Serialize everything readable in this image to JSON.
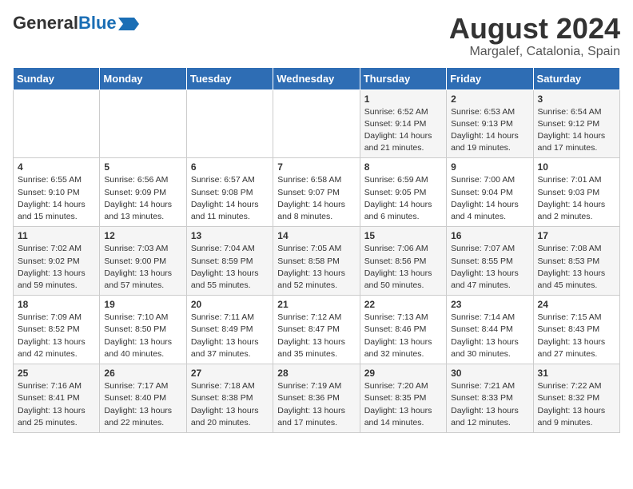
{
  "header": {
    "logo_general": "General",
    "logo_blue": "Blue",
    "title": "August 2024",
    "subtitle": "Margalef, Catalonia, Spain"
  },
  "days_of_week": [
    "Sunday",
    "Monday",
    "Tuesday",
    "Wednesday",
    "Thursday",
    "Friday",
    "Saturday"
  ],
  "weeks": [
    [
      {
        "day": "",
        "info": ""
      },
      {
        "day": "",
        "info": ""
      },
      {
        "day": "",
        "info": ""
      },
      {
        "day": "",
        "info": ""
      },
      {
        "day": "1",
        "info": "Sunrise: 6:52 AM\nSunset: 9:14 PM\nDaylight: 14 hours\nand 21 minutes."
      },
      {
        "day": "2",
        "info": "Sunrise: 6:53 AM\nSunset: 9:13 PM\nDaylight: 14 hours\nand 19 minutes."
      },
      {
        "day": "3",
        "info": "Sunrise: 6:54 AM\nSunset: 9:12 PM\nDaylight: 14 hours\nand 17 minutes."
      }
    ],
    [
      {
        "day": "4",
        "info": "Sunrise: 6:55 AM\nSunset: 9:10 PM\nDaylight: 14 hours\nand 15 minutes."
      },
      {
        "day": "5",
        "info": "Sunrise: 6:56 AM\nSunset: 9:09 PM\nDaylight: 14 hours\nand 13 minutes."
      },
      {
        "day": "6",
        "info": "Sunrise: 6:57 AM\nSunset: 9:08 PM\nDaylight: 14 hours\nand 11 minutes."
      },
      {
        "day": "7",
        "info": "Sunrise: 6:58 AM\nSunset: 9:07 PM\nDaylight: 14 hours\nand 8 minutes."
      },
      {
        "day": "8",
        "info": "Sunrise: 6:59 AM\nSunset: 9:05 PM\nDaylight: 14 hours\nand 6 minutes."
      },
      {
        "day": "9",
        "info": "Sunrise: 7:00 AM\nSunset: 9:04 PM\nDaylight: 14 hours\nand 4 minutes."
      },
      {
        "day": "10",
        "info": "Sunrise: 7:01 AM\nSunset: 9:03 PM\nDaylight: 14 hours\nand 2 minutes."
      }
    ],
    [
      {
        "day": "11",
        "info": "Sunrise: 7:02 AM\nSunset: 9:02 PM\nDaylight: 13 hours\nand 59 minutes."
      },
      {
        "day": "12",
        "info": "Sunrise: 7:03 AM\nSunset: 9:00 PM\nDaylight: 13 hours\nand 57 minutes."
      },
      {
        "day": "13",
        "info": "Sunrise: 7:04 AM\nSunset: 8:59 PM\nDaylight: 13 hours\nand 55 minutes."
      },
      {
        "day": "14",
        "info": "Sunrise: 7:05 AM\nSunset: 8:58 PM\nDaylight: 13 hours\nand 52 minutes."
      },
      {
        "day": "15",
        "info": "Sunrise: 7:06 AM\nSunset: 8:56 PM\nDaylight: 13 hours\nand 50 minutes."
      },
      {
        "day": "16",
        "info": "Sunrise: 7:07 AM\nSunset: 8:55 PM\nDaylight: 13 hours\nand 47 minutes."
      },
      {
        "day": "17",
        "info": "Sunrise: 7:08 AM\nSunset: 8:53 PM\nDaylight: 13 hours\nand 45 minutes."
      }
    ],
    [
      {
        "day": "18",
        "info": "Sunrise: 7:09 AM\nSunset: 8:52 PM\nDaylight: 13 hours\nand 42 minutes."
      },
      {
        "day": "19",
        "info": "Sunrise: 7:10 AM\nSunset: 8:50 PM\nDaylight: 13 hours\nand 40 minutes."
      },
      {
        "day": "20",
        "info": "Sunrise: 7:11 AM\nSunset: 8:49 PM\nDaylight: 13 hours\nand 37 minutes."
      },
      {
        "day": "21",
        "info": "Sunrise: 7:12 AM\nSunset: 8:47 PM\nDaylight: 13 hours\nand 35 minutes."
      },
      {
        "day": "22",
        "info": "Sunrise: 7:13 AM\nSunset: 8:46 PM\nDaylight: 13 hours\nand 32 minutes."
      },
      {
        "day": "23",
        "info": "Sunrise: 7:14 AM\nSunset: 8:44 PM\nDaylight: 13 hours\nand 30 minutes."
      },
      {
        "day": "24",
        "info": "Sunrise: 7:15 AM\nSunset: 8:43 PM\nDaylight: 13 hours\nand 27 minutes."
      }
    ],
    [
      {
        "day": "25",
        "info": "Sunrise: 7:16 AM\nSunset: 8:41 PM\nDaylight: 13 hours\nand 25 minutes."
      },
      {
        "day": "26",
        "info": "Sunrise: 7:17 AM\nSunset: 8:40 PM\nDaylight: 13 hours\nand 22 minutes."
      },
      {
        "day": "27",
        "info": "Sunrise: 7:18 AM\nSunset: 8:38 PM\nDaylight: 13 hours\nand 20 minutes."
      },
      {
        "day": "28",
        "info": "Sunrise: 7:19 AM\nSunset: 8:36 PM\nDaylight: 13 hours\nand 17 minutes."
      },
      {
        "day": "29",
        "info": "Sunrise: 7:20 AM\nSunset: 8:35 PM\nDaylight: 13 hours\nand 14 minutes."
      },
      {
        "day": "30",
        "info": "Sunrise: 7:21 AM\nSunset: 8:33 PM\nDaylight: 13 hours\nand 12 minutes."
      },
      {
        "day": "31",
        "info": "Sunrise: 7:22 AM\nSunset: 8:32 PM\nDaylight: 13 hours\nand 9 minutes."
      }
    ]
  ]
}
